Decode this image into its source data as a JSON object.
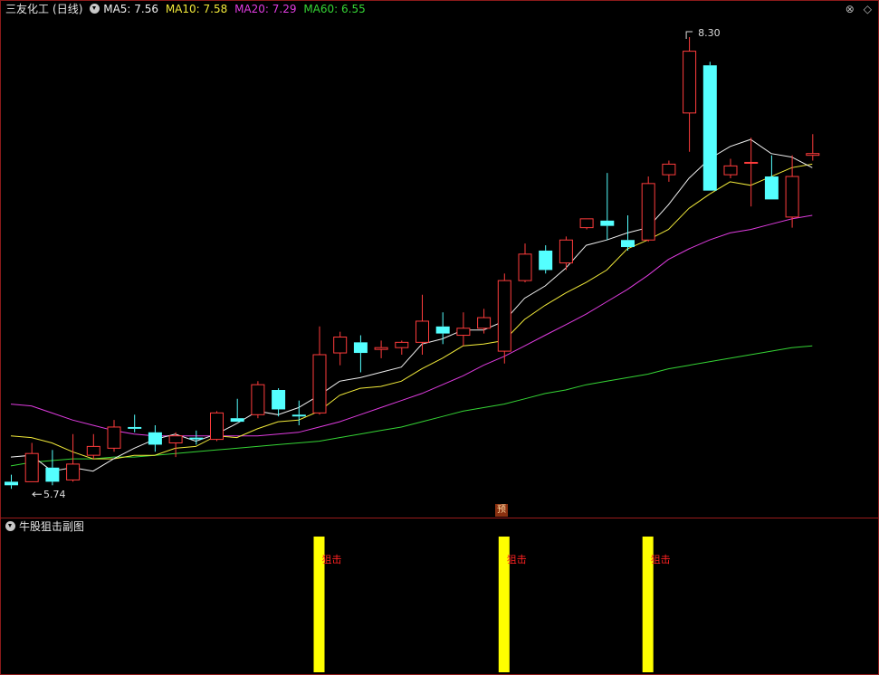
{
  "header": {
    "stock_name": "三友化工",
    "period": "(日线)",
    "ma5": "MA5: 7.56",
    "ma10": "MA10: 7.58",
    "ma20": "MA20: 7.29",
    "ma60": "MA60: 6.55",
    "icons": [
      "close-icon",
      "diamond-icon"
    ]
  },
  "sub_header": {
    "title": "牛股狙击副图"
  },
  "markers": {
    "yu": "预",
    "high_label": "8.30",
    "low_label": "5.74"
  },
  "signals": [
    {
      "label": "狙击"
    },
    {
      "label": "狙击"
    },
    {
      "label": "狙击"
    }
  ],
  "colors": {
    "up": "#ff3c3c",
    "down": "#54ffff",
    "ma5": "#f0f0f0",
    "ma10": "#f2ea3a",
    "ma20": "#e03ce0",
    "ma60": "#35d435",
    "signal_bar": "#ffff00",
    "signal_text": "#ff2222"
  },
  "chart_data": {
    "type": "candlestick",
    "series": [
      {
        "o": 5.78,
        "h": 5.82,
        "l": 5.74,
        "c": 5.76
      },
      {
        "o": 5.78,
        "h": 6.0,
        "l": 5.78,
        "c": 5.94
      },
      {
        "o": 5.86,
        "h": 5.96,
        "l": 5.76,
        "c": 5.78
      },
      {
        "o": 5.79,
        "h": 6.05,
        "l": 5.78,
        "c": 5.88
      },
      {
        "o": 5.93,
        "h": 6.05,
        "l": 5.91,
        "c": 5.98
      },
      {
        "o": 5.97,
        "h": 6.13,
        "l": 5.95,
        "c": 6.09
      },
      {
        "o": 6.09,
        "h": 6.16,
        "l": 6.06,
        "c": 6.08
      },
      {
        "o": 6.06,
        "h": 6.1,
        "l": 5.95,
        "c": 5.99
      },
      {
        "o": 6.0,
        "h": 6.06,
        "l": 5.92,
        "c": 6.04
      },
      {
        "o": 6.03,
        "h": 6.07,
        "l": 5.99,
        "c": 6.02
      },
      {
        "o": 6.02,
        "h": 6.18,
        "l": 6.01,
        "c": 6.17
      },
      {
        "o": 6.14,
        "h": 6.25,
        "l": 6.12,
        "c": 6.12
      },
      {
        "o": 6.16,
        "h": 6.35,
        "l": 6.14,
        "c": 6.33
      },
      {
        "o": 6.3,
        "h": 6.31,
        "l": 6.15,
        "c": 6.19
      },
      {
        "o": 6.16,
        "h": 6.24,
        "l": 6.1,
        "c": 6.15
      },
      {
        "o": 6.17,
        "h": 6.66,
        "l": 6.16,
        "c": 6.5
      },
      {
        "o": 6.51,
        "h": 6.63,
        "l": 6.44,
        "c": 6.6
      },
      {
        "o": 6.57,
        "h": 6.61,
        "l": 6.4,
        "c": 6.51
      },
      {
        "o": 6.53,
        "h": 6.58,
        "l": 6.48,
        "c": 6.54
      },
      {
        "o": 6.54,
        "h": 6.58,
        "l": 6.5,
        "c": 6.57
      },
      {
        "o": 6.57,
        "h": 6.84,
        "l": 6.5,
        "c": 6.69
      },
      {
        "o": 6.66,
        "h": 6.74,
        "l": 6.56,
        "c": 6.62
      },
      {
        "o": 6.61,
        "h": 6.74,
        "l": 6.55,
        "c": 6.65
      },
      {
        "o": 6.65,
        "h": 6.76,
        "l": 6.62,
        "c": 6.71
      },
      {
        "o": 6.52,
        "h": 6.96,
        "l": 6.45,
        "c": 6.92
      },
      {
        "o": 6.92,
        "h": 7.13,
        "l": 6.91,
        "c": 7.07
      },
      {
        "o": 7.09,
        "h": 7.12,
        "l": 6.96,
        "c": 6.98
      },
      {
        "o": 7.02,
        "h": 7.17,
        "l": 6.98,
        "c": 7.15
      },
      {
        "o": 7.22,
        "h": 7.27,
        "l": 7.21,
        "c": 7.27
      },
      {
        "o": 7.26,
        "h": 7.53,
        "l": 7.15,
        "c": 7.23
      },
      {
        "o": 7.15,
        "h": 7.29,
        "l": 7.09,
        "c": 7.11
      },
      {
        "o": 7.15,
        "h": 7.51,
        "l": 7.14,
        "c": 7.47
      },
      {
        "o": 7.52,
        "h": 7.6,
        "l": 7.48,
        "c": 7.58
      },
      {
        "o": 7.87,
        "h": 8.3,
        "l": 7.65,
        "c": 8.22
      },
      {
        "o": 8.14,
        "h": 8.16,
        "l": 7.43,
        "c": 7.43
      },
      {
        "o": 7.52,
        "h": 7.61,
        "l": 7.5,
        "c": 7.57
      },
      {
        "o": 7.59,
        "h": 7.73,
        "l": 7.34,
        "c": 7.59
      },
      {
        "o": 7.51,
        "h": 7.63,
        "l": 7.38,
        "c": 7.38
      },
      {
        "o": 7.28,
        "h": 7.63,
        "l": 7.22,
        "c": 7.51
      },
      {
        "o": 7.63,
        "h": 7.75,
        "l": 7.6,
        "c": 7.64
      }
    ],
    "ma5": [
      5.92,
      5.93,
      5.84,
      5.86,
      5.84,
      5.91,
      5.97,
      6.02,
      6.05,
      6.01,
      6.05,
      6.11,
      6.18,
      6.16,
      6.2,
      6.27,
      6.35,
      6.37,
      6.4,
      6.43,
      6.56,
      6.59,
      6.64,
      6.64,
      6.69,
      6.82,
      6.89,
      6.99,
      7.12,
      7.15,
      7.19,
      7.22,
      7.35,
      7.5,
      7.61,
      7.68,
      7.72,
      7.64,
      7.62,
      7.56
    ],
    "ma10": [
      6.04,
      6.03,
      6.0,
      5.95,
      5.91,
      5.91,
      5.93,
      5.93,
      5.97,
      5.98,
      6.04,
      6.03,
      6.08,
      6.12,
      6.13,
      6.18,
      6.27,
      6.31,
      6.32,
      6.35,
      6.42,
      6.48,
      6.55,
      6.56,
      6.58,
      6.7,
      6.78,
      6.85,
      6.91,
      6.98,
      7.1,
      7.15,
      7.21,
      7.33,
      7.41,
      7.48,
      7.46,
      7.51,
      7.56,
      7.58
    ],
    "ma20": [
      6.22,
      6.21,
      6.17,
      6.13,
      6.1,
      6.07,
      6.05,
      6.04,
      6.04,
      6.04,
      6.04,
      6.04,
      6.04,
      6.05,
      6.06,
      6.09,
      6.12,
      6.16,
      6.2,
      6.24,
      6.28,
      6.33,
      6.38,
      6.44,
      6.49,
      6.55,
      6.61,
      6.67,
      6.73,
      6.8,
      6.87,
      6.95,
      7.04,
      7.1,
      7.15,
      7.19,
      7.21,
      7.24,
      7.27,
      7.29
    ],
    "ma60": [
      5.87,
      5.89,
      5.9,
      5.91,
      5.91,
      5.92,
      5.92,
      5.93,
      5.94,
      5.95,
      5.96,
      5.97,
      5.98,
      5.99,
      6.0,
      6.01,
      6.03,
      6.05,
      6.07,
      6.09,
      6.12,
      6.15,
      6.18,
      6.2,
      6.22,
      6.25,
      6.28,
      6.3,
      6.33,
      6.35,
      6.37,
      6.39,
      6.42,
      6.44,
      6.46,
      6.48,
      6.5,
      6.52,
      6.54,
      6.55
    ],
    "signal_indices": [
      15,
      24,
      31
    ],
    "high_marker": {
      "index": 33,
      "value": 8.3
    },
    "low_marker": {
      "index": 0,
      "value": 5.74
    }
  }
}
